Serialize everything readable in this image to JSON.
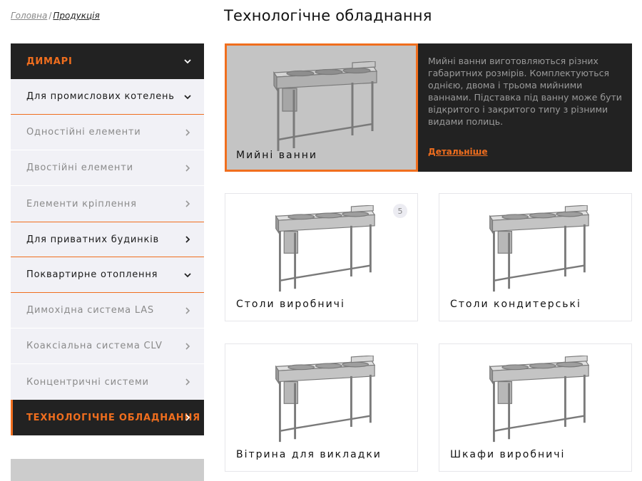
{
  "breadcrumb": {
    "home": "Головна",
    "separator": "/",
    "current": "Продукція"
  },
  "page_title": "Технологічне обладнання",
  "sidebar": {
    "items": [
      {
        "label": "ДИМАРІ",
        "style": "dark",
        "icon": "chevron-down-icon"
      },
      {
        "label": "Для промислових котелень",
        "style": "level1",
        "icon": "chevron-down-icon"
      },
      {
        "label": "Одностійні елементи",
        "style": "level2",
        "icon": "chevron-right-icon"
      },
      {
        "label": "Двостійні елементи",
        "style": "level2",
        "icon": "chevron-right-icon"
      },
      {
        "label": "Елементи кріплення",
        "style": "level2",
        "icon": "chevron-right-icon"
      },
      {
        "label": "Для приватних будинків",
        "style": "level1",
        "icon": "chevron-right-icon"
      },
      {
        "label": "Поквартирне отоплення",
        "style": "level1",
        "icon": "chevron-down-icon"
      },
      {
        "label": "Димохідна система LAS",
        "style": "level2",
        "icon": "chevron-right-icon"
      },
      {
        "label": "Коаксіальна система CLV",
        "style": "level2",
        "icon": "chevron-right-icon"
      },
      {
        "label": "Концентричні системи",
        "style": "level2",
        "icon": "chevron-right-icon"
      },
      {
        "label": "ТЕХНОЛОГІЧНЕ ОБЛАДНАННЯ",
        "style": "active",
        "icon": "chevron-right-icon"
      }
    ]
  },
  "featured": {
    "name": "Мийні ванни",
    "description": "Мийні ванни виготовляються різних габаритних розмірів. Комплектуються однією, двома і трьома мийними ваннами. Підставка під ванну може бути відкритого і закритого типу з різними видами полиць.",
    "link": "Детальніше"
  },
  "cards": [
    {
      "name": "Столи виробничі",
      "badge": "5"
    },
    {
      "name": "Столи кондитерські",
      "badge": ""
    },
    {
      "name": "Вітрина для викладки",
      "badge": ""
    },
    {
      "name": "Шкафи виробничі",
      "badge": ""
    }
  ],
  "colors": {
    "accent": "#f06e1e",
    "dark": "#222222",
    "menu_bg": "#f1f1f6",
    "featured_img_bg": "#c4c4c4"
  }
}
